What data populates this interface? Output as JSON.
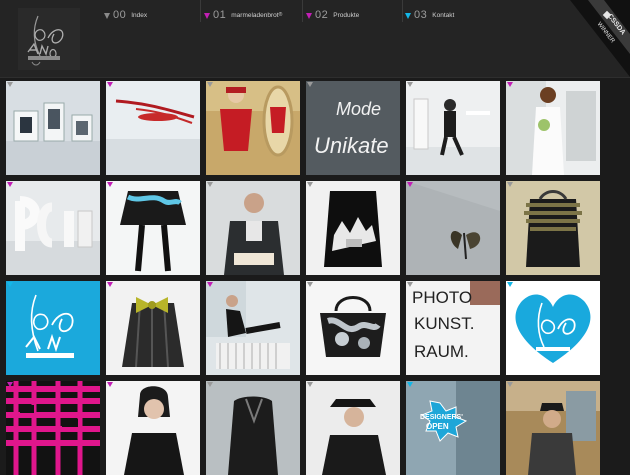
{
  "brand": {
    "logo_icon": "deavoe-logo-icon",
    "accent_magenta": "#c21fb5",
    "accent_cyan": "#13b7e8"
  },
  "nav": [
    {
      "num": "00",
      "label": "Index",
      "marker": "#8a8a8a"
    },
    {
      "num": "01",
      "label": "marmeladenbrot",
      "sup": "®",
      "marker": "#c21fb5"
    },
    {
      "num": "02",
      "label": "Produkte",
      "marker": "#c21fb5"
    },
    {
      "num": "03",
      "label": "Kontakt",
      "marker": "#13b7e8"
    }
  ],
  "badge": {
    "brand": "CSSDA",
    "label": "WINNER"
  },
  "tiles_text": {
    "mode": "Mode",
    "unikate": "Unikate",
    "photo": "PHOTO",
    "kunst": "KUNST.",
    "raum": "RAUM.",
    "designers": "DESIGNERS'",
    "open": "OPEN"
  }
}
